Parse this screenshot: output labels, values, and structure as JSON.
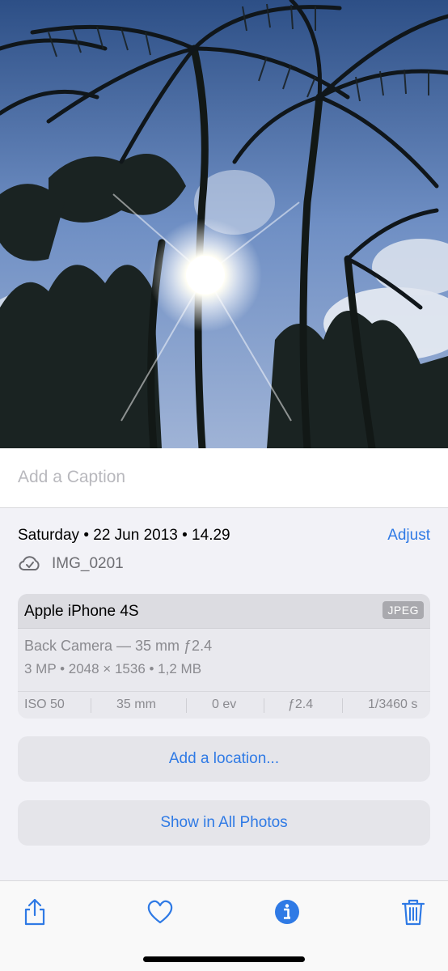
{
  "photo": {
    "subject": "palm-trees-sun-photo"
  },
  "caption": {
    "placeholder": "Add a Caption"
  },
  "info": {
    "date_time": "Saturday • 22 Jun 2013 • 14.29",
    "adjust_label": "Adjust",
    "filename": "IMG_0201"
  },
  "metadata": {
    "device": "Apple iPhone 4S",
    "format": "JPEG",
    "lens": "Back Camera — 35 mm ƒ2.4",
    "specs": "3 MP  •  2048 × 1536  •  1,2 MB",
    "exif": {
      "iso": "ISO 50",
      "focal": "35 mm",
      "ev": "0 ev",
      "aperture": "ƒ2.4",
      "shutter": "1/3460 s"
    }
  },
  "actions": {
    "location_label": "Add a location...",
    "show_all_label": "Show in All Photos"
  },
  "toolbar": {
    "icons": [
      "share-icon",
      "heart-icon",
      "info-icon",
      "trash-icon"
    ]
  },
  "colors": {
    "accent": "#2f7ae5",
    "background": "#f2f2f7"
  }
}
